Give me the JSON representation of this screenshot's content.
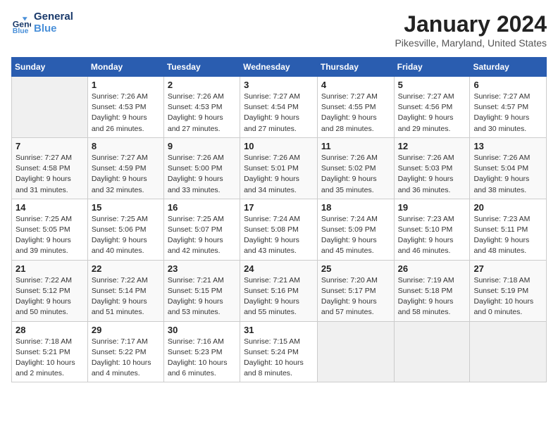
{
  "header": {
    "logo_line1": "General",
    "logo_line2": "Blue",
    "month": "January 2024",
    "location": "Pikesville, Maryland, United States"
  },
  "days_of_week": [
    "Sunday",
    "Monday",
    "Tuesday",
    "Wednesday",
    "Thursday",
    "Friday",
    "Saturday"
  ],
  "weeks": [
    [
      {
        "day": "",
        "info": ""
      },
      {
        "day": "1",
        "info": "Sunrise: 7:26 AM\nSunset: 4:53 PM\nDaylight: 9 hours\nand 26 minutes."
      },
      {
        "day": "2",
        "info": "Sunrise: 7:26 AM\nSunset: 4:53 PM\nDaylight: 9 hours\nand 27 minutes."
      },
      {
        "day": "3",
        "info": "Sunrise: 7:27 AM\nSunset: 4:54 PM\nDaylight: 9 hours\nand 27 minutes."
      },
      {
        "day": "4",
        "info": "Sunrise: 7:27 AM\nSunset: 4:55 PM\nDaylight: 9 hours\nand 28 minutes."
      },
      {
        "day": "5",
        "info": "Sunrise: 7:27 AM\nSunset: 4:56 PM\nDaylight: 9 hours\nand 29 minutes."
      },
      {
        "day": "6",
        "info": "Sunrise: 7:27 AM\nSunset: 4:57 PM\nDaylight: 9 hours\nand 30 minutes."
      }
    ],
    [
      {
        "day": "7",
        "info": "Sunrise: 7:27 AM\nSunset: 4:58 PM\nDaylight: 9 hours\nand 31 minutes."
      },
      {
        "day": "8",
        "info": "Sunrise: 7:27 AM\nSunset: 4:59 PM\nDaylight: 9 hours\nand 32 minutes."
      },
      {
        "day": "9",
        "info": "Sunrise: 7:26 AM\nSunset: 5:00 PM\nDaylight: 9 hours\nand 33 minutes."
      },
      {
        "day": "10",
        "info": "Sunrise: 7:26 AM\nSunset: 5:01 PM\nDaylight: 9 hours\nand 34 minutes."
      },
      {
        "day": "11",
        "info": "Sunrise: 7:26 AM\nSunset: 5:02 PM\nDaylight: 9 hours\nand 35 minutes."
      },
      {
        "day": "12",
        "info": "Sunrise: 7:26 AM\nSunset: 5:03 PM\nDaylight: 9 hours\nand 36 minutes."
      },
      {
        "day": "13",
        "info": "Sunrise: 7:26 AM\nSunset: 5:04 PM\nDaylight: 9 hours\nand 38 minutes."
      }
    ],
    [
      {
        "day": "14",
        "info": "Sunrise: 7:25 AM\nSunset: 5:05 PM\nDaylight: 9 hours\nand 39 minutes."
      },
      {
        "day": "15",
        "info": "Sunrise: 7:25 AM\nSunset: 5:06 PM\nDaylight: 9 hours\nand 40 minutes."
      },
      {
        "day": "16",
        "info": "Sunrise: 7:25 AM\nSunset: 5:07 PM\nDaylight: 9 hours\nand 42 minutes."
      },
      {
        "day": "17",
        "info": "Sunrise: 7:24 AM\nSunset: 5:08 PM\nDaylight: 9 hours\nand 43 minutes."
      },
      {
        "day": "18",
        "info": "Sunrise: 7:24 AM\nSunset: 5:09 PM\nDaylight: 9 hours\nand 45 minutes."
      },
      {
        "day": "19",
        "info": "Sunrise: 7:23 AM\nSunset: 5:10 PM\nDaylight: 9 hours\nand 46 minutes."
      },
      {
        "day": "20",
        "info": "Sunrise: 7:23 AM\nSunset: 5:11 PM\nDaylight: 9 hours\nand 48 minutes."
      }
    ],
    [
      {
        "day": "21",
        "info": "Sunrise: 7:22 AM\nSunset: 5:12 PM\nDaylight: 9 hours\nand 50 minutes."
      },
      {
        "day": "22",
        "info": "Sunrise: 7:22 AM\nSunset: 5:14 PM\nDaylight: 9 hours\nand 51 minutes."
      },
      {
        "day": "23",
        "info": "Sunrise: 7:21 AM\nSunset: 5:15 PM\nDaylight: 9 hours\nand 53 minutes."
      },
      {
        "day": "24",
        "info": "Sunrise: 7:21 AM\nSunset: 5:16 PM\nDaylight: 9 hours\nand 55 minutes."
      },
      {
        "day": "25",
        "info": "Sunrise: 7:20 AM\nSunset: 5:17 PM\nDaylight: 9 hours\nand 57 minutes."
      },
      {
        "day": "26",
        "info": "Sunrise: 7:19 AM\nSunset: 5:18 PM\nDaylight: 9 hours\nand 58 minutes."
      },
      {
        "day": "27",
        "info": "Sunrise: 7:18 AM\nSunset: 5:19 PM\nDaylight: 10 hours\nand 0 minutes."
      }
    ],
    [
      {
        "day": "28",
        "info": "Sunrise: 7:18 AM\nSunset: 5:21 PM\nDaylight: 10 hours\nand 2 minutes."
      },
      {
        "day": "29",
        "info": "Sunrise: 7:17 AM\nSunset: 5:22 PM\nDaylight: 10 hours\nand 4 minutes."
      },
      {
        "day": "30",
        "info": "Sunrise: 7:16 AM\nSunset: 5:23 PM\nDaylight: 10 hours\nand 6 minutes."
      },
      {
        "day": "31",
        "info": "Sunrise: 7:15 AM\nSunset: 5:24 PM\nDaylight: 10 hours\nand 8 minutes."
      },
      {
        "day": "",
        "info": ""
      },
      {
        "day": "",
        "info": ""
      },
      {
        "day": "",
        "info": ""
      }
    ]
  ]
}
